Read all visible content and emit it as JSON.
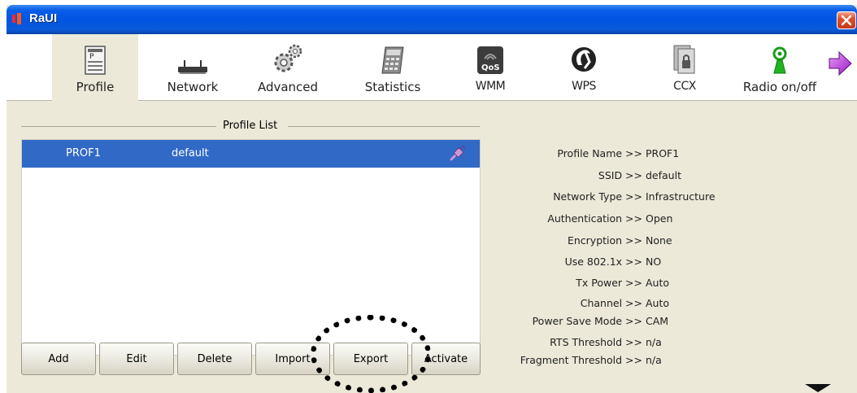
{
  "window": {
    "title": "RaUI"
  },
  "colors": {
    "selection": "#3169c6",
    "titlebar": "#0054e3",
    "close": "#e0502a"
  },
  "toolbar": {
    "items": [
      {
        "label": "Profile",
        "icon": "profile-icon",
        "selected": true
      },
      {
        "label": "Network",
        "icon": "network-icon"
      },
      {
        "label": "Advanced",
        "icon": "advanced-gear-icon"
      },
      {
        "label": "Statistics",
        "icon": "statistics-calculator-icon"
      },
      {
        "label": "WMM",
        "icon": "qos-icon"
      },
      {
        "label": "WPS",
        "icon": "wps-icon"
      },
      {
        "label": "CCX",
        "icon": "ccx-icon"
      },
      {
        "label": "Radio on/off",
        "icon": "radio-antenna-icon"
      }
    ],
    "next_icon": "next-arrow-icon"
  },
  "profile_list": {
    "title": "Profile List",
    "rows": [
      {
        "name": "PROF1",
        "ssid": "default",
        "status_icon": "connected-plug-icon",
        "selected": true
      }
    ]
  },
  "buttons": {
    "add": "Add",
    "edit": "Edit",
    "delete": "Delete",
    "import": "Import",
    "export": "Export",
    "activate": "Activate"
  },
  "details": [
    {
      "key": "Profile Name >>",
      "value": "PROF1"
    },
    {
      "key": "SSID >>",
      "value": "default"
    },
    {
      "key": "Network Type >>",
      "value": "Infrastructure"
    },
    {
      "key": "Authentication >>",
      "value": "Open"
    },
    {
      "key": "Encryption >>",
      "value": "None"
    },
    {
      "key": "Use 802.1x >>",
      "value": "NO"
    },
    {
      "key": "Tx Power >>",
      "value": "Auto"
    },
    {
      "key": "Channel >>",
      "value": "Auto"
    },
    {
      "key": "Power Save Mode >>",
      "value": "CAM"
    },
    {
      "key": "RTS Threshold >>",
      "value": "n/a"
    },
    {
      "key": "Fragment Threshold >>",
      "value": "n/a"
    }
  ]
}
